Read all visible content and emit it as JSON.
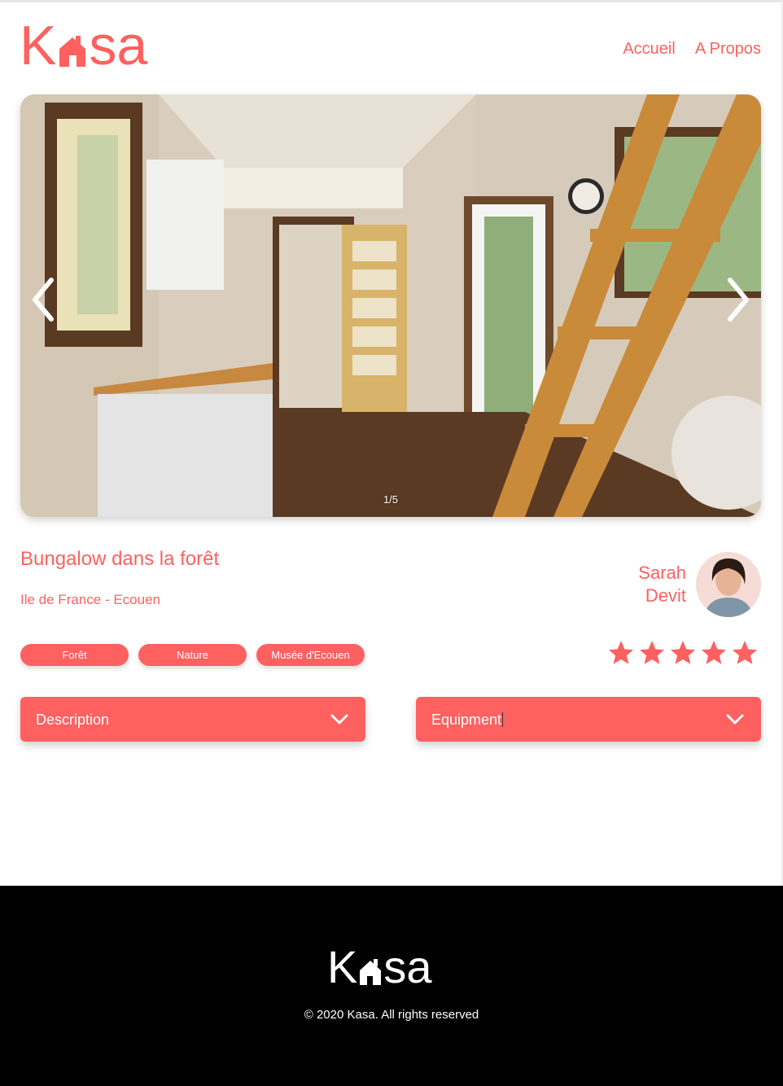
{
  "brand": {
    "logo_left": "K",
    "logo_right": "sa",
    "color": "#FF6060"
  },
  "nav": {
    "home": "Accueil",
    "about": "A Propos"
  },
  "carousel": {
    "counter": "1/5",
    "prev_icon": "chevron-left-icon",
    "next_icon": "chevron-right-icon"
  },
  "listing": {
    "title": "Bungalow dans la forêt",
    "location": "Ile de France - Ecouen",
    "tags": [
      "Forêt",
      "Nature",
      "Musée d'Ecouen"
    ],
    "rating": 5,
    "rating_max": 5
  },
  "host": {
    "first_name": "Sarah",
    "last_name": "Devit"
  },
  "collapses": {
    "description": "Description",
    "equipment": "Equipment"
  },
  "footer": {
    "copyright": "© 2020 Kasa. All rights reserved"
  }
}
